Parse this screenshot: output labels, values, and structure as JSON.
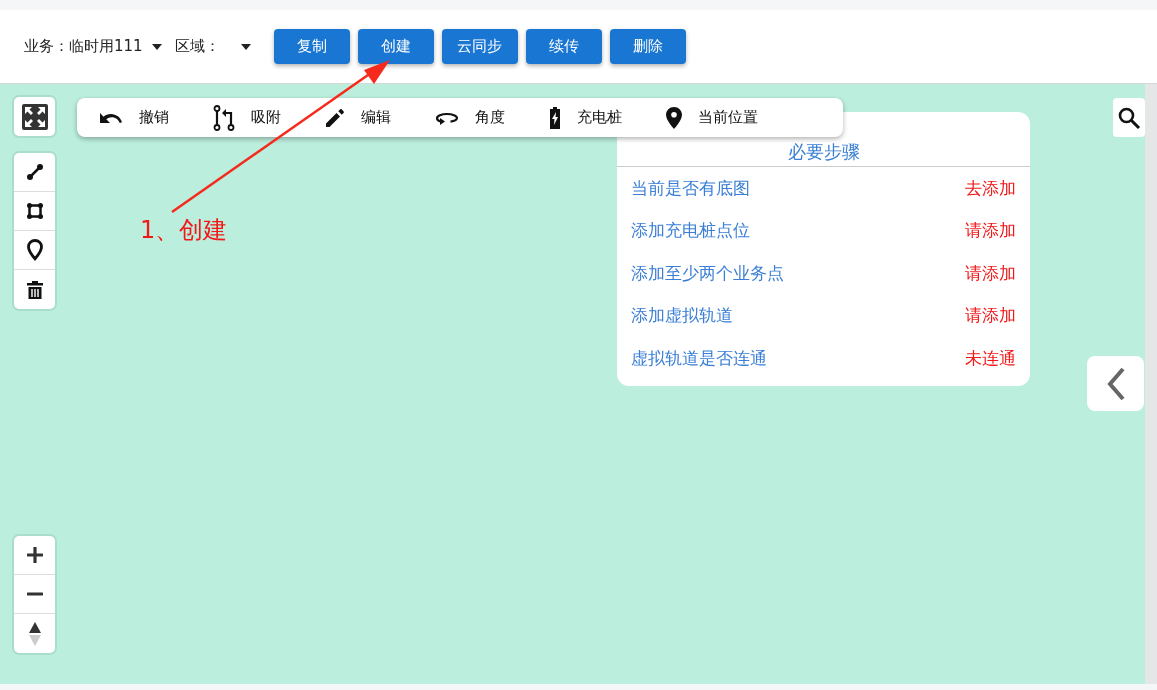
{
  "header": {
    "business_label": "业务：",
    "business_value": "临时用111",
    "region_label": "区域：",
    "buttons": [
      "复制",
      "创建",
      "云同步",
      "续传",
      "删除"
    ]
  },
  "toolbar": [
    {
      "kind": "undo",
      "label": "撤销"
    },
    {
      "kind": "snap",
      "label": "吸附"
    },
    {
      "kind": "edit",
      "label": "编辑"
    },
    {
      "kind": "angle",
      "label": "角度"
    },
    {
      "kind": "charger",
      "label": "充电桩"
    },
    {
      "kind": "location",
      "label": "当前位置"
    }
  ],
  "draw_tools": [
    {
      "kind": "line"
    },
    {
      "kind": "polygon"
    },
    {
      "kind": "marker"
    },
    {
      "kind": "trash"
    }
  ],
  "zoom_controls": [
    {
      "kind": "plus"
    },
    {
      "kind": "minus"
    },
    {
      "kind": "compass"
    }
  ],
  "steps_panel": {
    "title": "必要步骤",
    "items": [
      {
        "label": "当前是否有底图",
        "action": "去添加"
      },
      {
        "label": "添加充电桩点位",
        "action": "请添加"
      },
      {
        "label": "添加至少两个业务点",
        "action": "请添加"
      },
      {
        "label": "添加虚拟轨道",
        "action": "请添加"
      },
      {
        "label": "虚拟轨道是否连通",
        "action": "未连通"
      }
    ]
  },
  "annotation": {
    "text": "1、创建"
  }
}
